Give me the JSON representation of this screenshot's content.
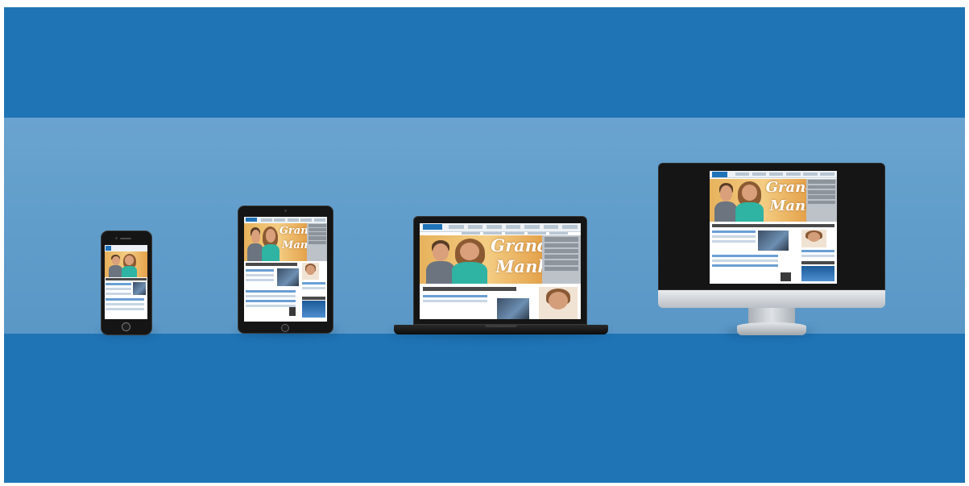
{
  "scene": {
    "colors": {
      "background_blue": "#1f74b5",
      "band_light_blue": "#6aa3cf",
      "device_black": "#151515",
      "monitor_silver": "#d9dde1",
      "site_blue": "#2173b8",
      "hero_orange": "#e7b25c"
    },
    "devices": [
      {
        "id": "smartphone",
        "type": "phone"
      },
      {
        "id": "tablet",
        "type": "tablet"
      },
      {
        "id": "laptop",
        "type": "laptop"
      },
      {
        "id": "desktop",
        "type": "monitor"
      }
    ],
    "website": {
      "hero_text_line1": "Grandes",
      "hero_text_line2": "Manhãs",
      "laptop_hero_line1": "Grandes",
      "laptop_hero_line2": "Manhãs",
      "desktop_hero_line1": "Grandes",
      "desktop_hero_line2": "Manhãs",
      "tablet_hero_line1": "Grandes",
      "tablet_hero_line2": "Manhãs"
    }
  }
}
